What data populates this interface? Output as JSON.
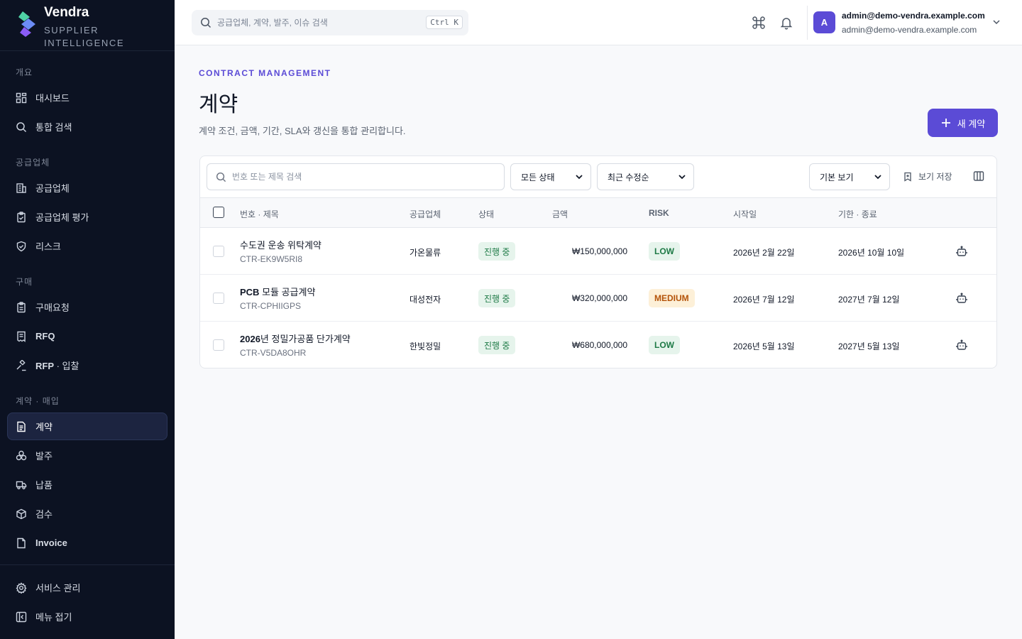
{
  "brand": {
    "name": "Vendra",
    "subtitle": "SUPPLIER INTELLIGENCE"
  },
  "sidebar": {
    "sections": [
      {
        "label": "개요",
        "items": [
          {
            "label": "대시보드",
            "icon": "dashboard-icon"
          },
          {
            "label": "통합 검색",
            "icon": "search-icon"
          }
        ]
      },
      {
        "label": "공급업체",
        "items": [
          {
            "label": "공급업체",
            "icon": "building-icon"
          },
          {
            "label": "공급업체 평가",
            "icon": "clipboard-check-icon"
          },
          {
            "label": "리스크",
            "icon": "shield-check-icon"
          }
        ]
      },
      {
        "label": "구매",
        "items": [
          {
            "label": "구매요청",
            "icon": "clipboard-list-icon"
          },
          {
            "label": "RFQ",
            "icon": "receipt-icon"
          },
          {
            "label": "RFP · 입찰",
            "icon": "gavel-icon"
          }
        ]
      },
      {
        "label": "계약 · 매입",
        "items": [
          {
            "label": "계약",
            "icon": "file-text-icon",
            "active": true
          },
          {
            "label": "발주",
            "icon": "boxes-icon"
          },
          {
            "label": "납품",
            "icon": "truck-icon"
          },
          {
            "label": "검수",
            "icon": "package-check-icon"
          },
          {
            "label": "Invoice",
            "icon": "file-icon"
          }
        ]
      }
    ],
    "bottom": [
      {
        "label": "서비스 관리",
        "icon": "gear-icon"
      },
      {
        "label": "메뉴 접기",
        "icon": "panel-collapse-icon"
      }
    ]
  },
  "header": {
    "search_placeholder": "공급업체, 계약, 발주, 이슈 검색",
    "shortcut": "Ctrl K",
    "user": {
      "initial": "A",
      "name": "admin@demo-vendra.example.com",
      "email": "admin@demo-vendra.example.com"
    }
  },
  "page": {
    "eyebrow": "CONTRACT MANAGEMENT",
    "title": "계약",
    "description": "계약 조건, 금액, 기간, SLA와 갱신을 통합 관리합니다.",
    "new_button": "새 계약"
  },
  "toolbar": {
    "search_placeholder": "번호 또는 제목 검색",
    "status_filter": "모든 상태",
    "sort": "최근 수정순",
    "view": "기본 보기",
    "save_view": "보기 저장"
  },
  "table": {
    "columns": {
      "title": "번호 · 제목",
      "supplier": "공급업체",
      "status": "상태",
      "amount": "금액",
      "risk": "RISK",
      "start": "시작일",
      "end": "기한 · 종료"
    },
    "rows": [
      {
        "title": "수도권 운송 위탁계약",
        "code": "CTR-EK9W5RI8",
        "supplier": "가온물류",
        "status": "진행 중",
        "amount": "₩150,000,000",
        "risk": "LOW",
        "start": "2026년 2월 22일",
        "end": "2026년 10월 10일"
      },
      {
        "title": "PCB 모듈 공급계약",
        "code": "CTR-CPHIIGPS",
        "supplier": "대성전자",
        "status": "진행 중",
        "amount": "₩320,000,000",
        "risk": "MEDIUM",
        "start": "2026년 7월 12일",
        "end": "2027년 7월 12일"
      },
      {
        "title": "2026년 정밀가공품 단가계약",
        "code": "CTR-V5DA8OHR",
        "supplier": "한빛정밀",
        "status": "진행 중",
        "amount": "₩680,000,000",
        "risk": "LOW",
        "start": "2026년 5월 13일",
        "end": "2027년 5월 13일"
      }
    ]
  },
  "colors": {
    "accent": "#5b4bd6",
    "sidebar_bg": "#0c1222",
    "risk_low_bg": "#e6f4ec",
    "risk_low_fg": "#1e7a46",
    "risk_medium_bg": "#fdf0d8",
    "risk_medium_fg": "#b45309"
  }
}
